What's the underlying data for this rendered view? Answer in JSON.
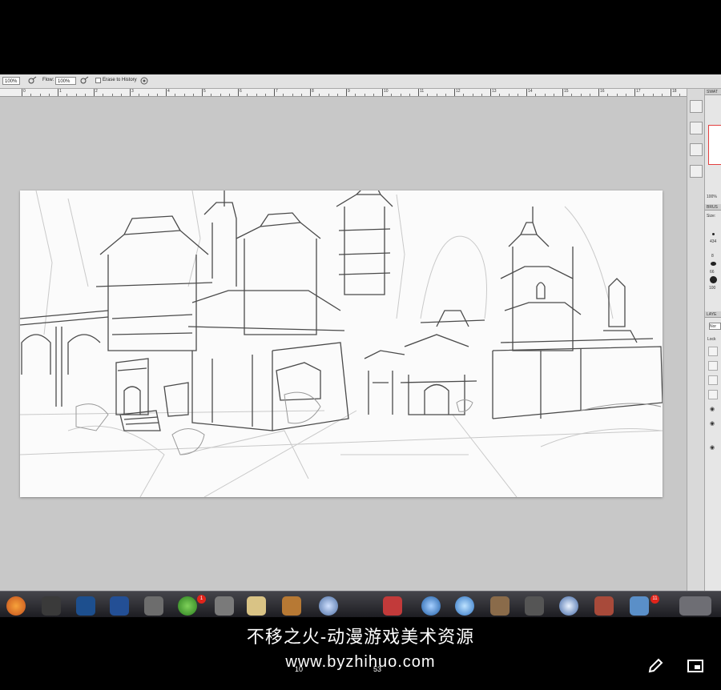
{
  "options_bar": {
    "brush_size": "100%",
    "flow_label": "Flow:",
    "flow_value": "100%",
    "erase_to_history_label": "Erase to History",
    "icons": [
      "airbrush-icon",
      "airbrush-icon",
      "tablet-pressure-icon"
    ]
  },
  "ruler": {
    "numbers": [
      "0",
      "1",
      "2",
      "3",
      "4",
      "5",
      "6",
      "7",
      "8",
      "9",
      "10",
      "11",
      "12",
      "13",
      "14",
      "15",
      "16",
      "17",
      "18"
    ]
  },
  "canvas": {
    "content": "pencil sketch of an asian-style temple city street"
  },
  "right_panels": {
    "swatches_tab": "SWAT",
    "zoom_readout": "100%",
    "brushes_tab": "BRUS",
    "size_label": "Size:",
    "brush_sizes": [
      "434",
      "8",
      "66",
      "100"
    ],
    "layers_tab": "LAYE",
    "lock_label": "Lock",
    "blend_mode": "Nor"
  },
  "dock": {
    "badge_left": "1",
    "badge_right": "11"
  },
  "player": {
    "watermark_title": "不移之火-动漫游戏美术资源",
    "watermark_url": "www.byzhihuo.com",
    "time_current": "10",
    "time_total": "53"
  },
  "colors": {
    "app_bg": "#c8c8c8",
    "canvas_bg": "#fbfbfb",
    "accent_red": "#e34040"
  }
}
